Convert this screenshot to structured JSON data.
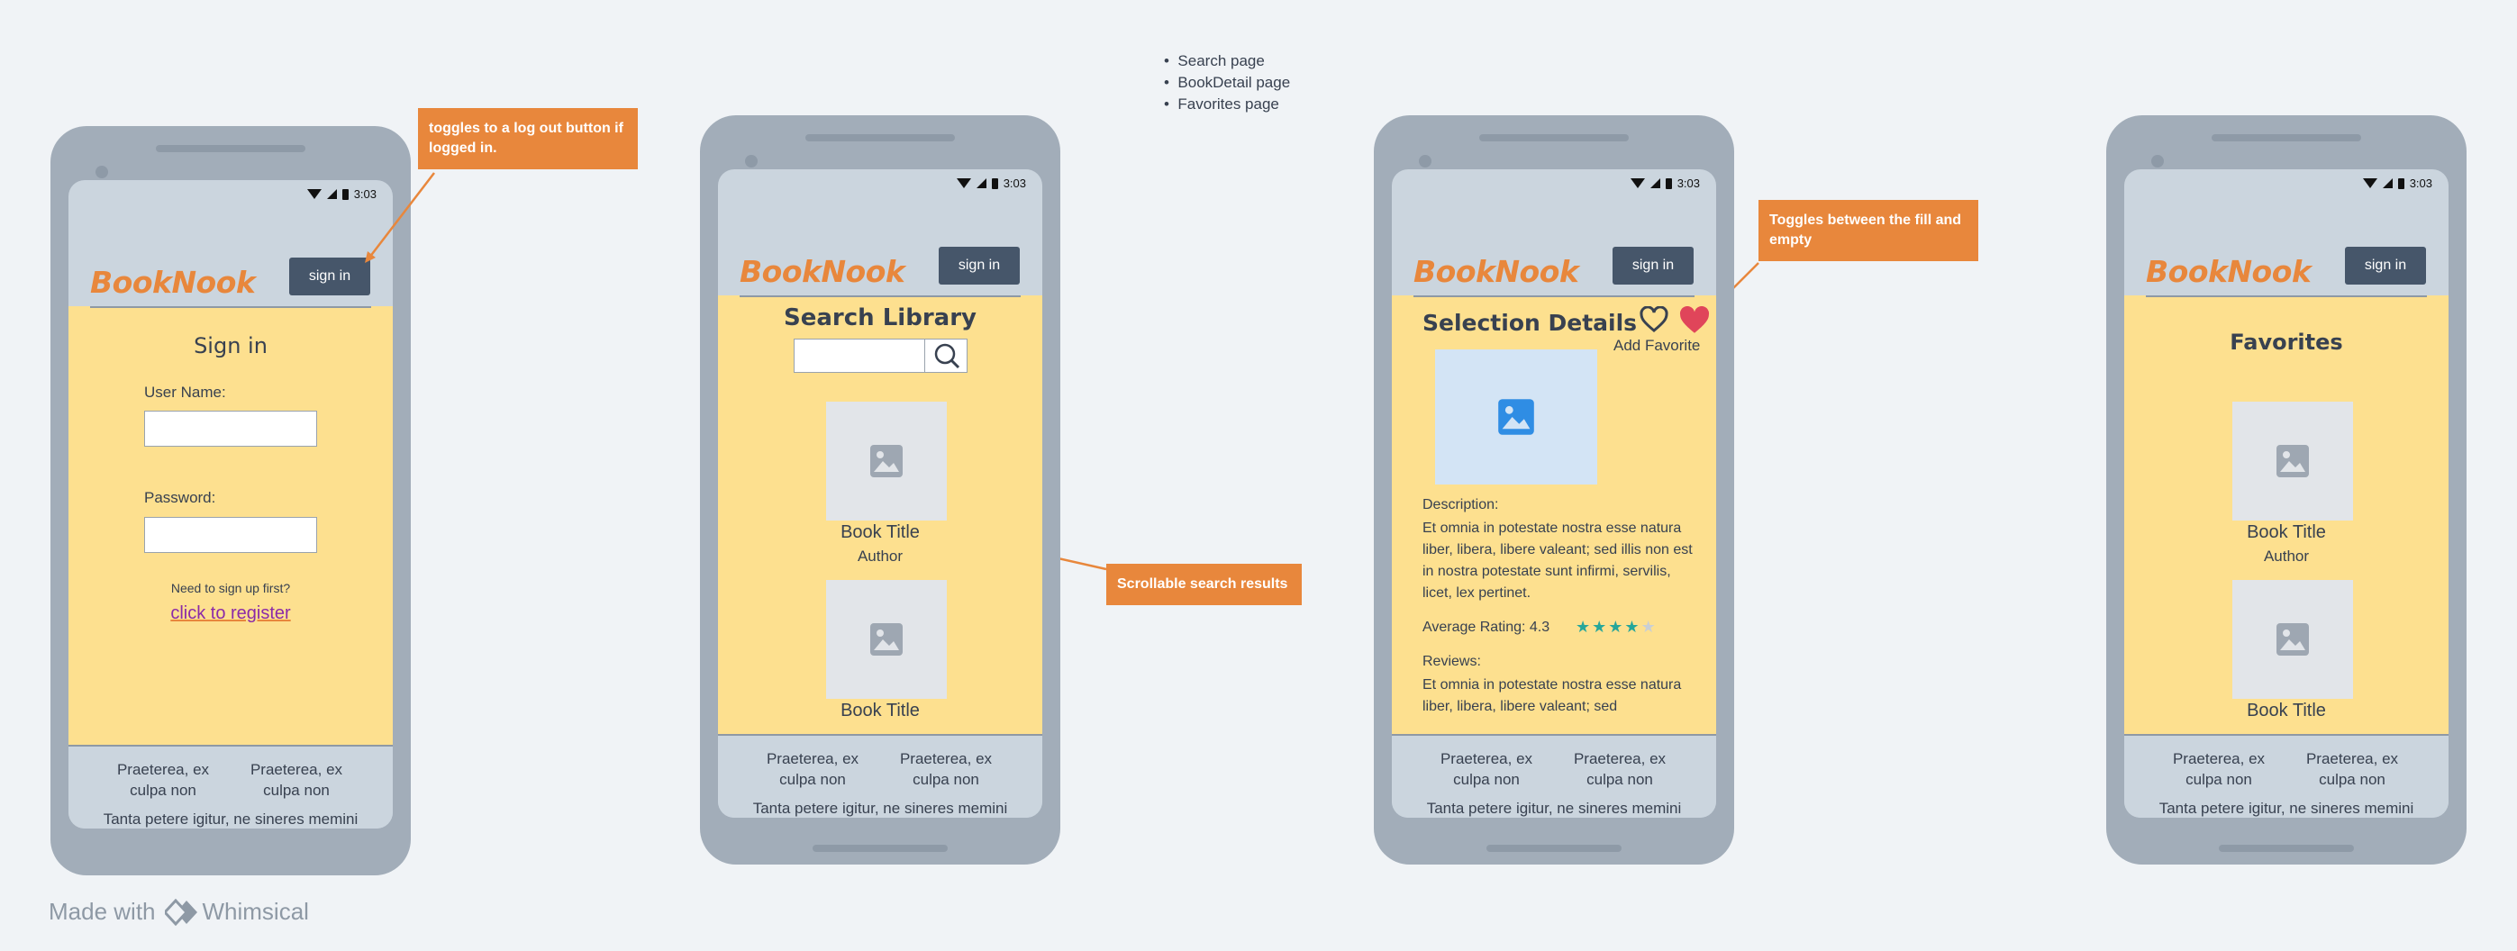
{
  "notes": {
    "bullets": [
      "Search page",
      "BookDetail page",
      "Favorites page"
    ],
    "toggle_logout": "toggles to a log out button if logged in.",
    "scrollable": "Scrollable search results",
    "toggle_fill": "Toggles between the fill and empty"
  },
  "common": {
    "time": "3:03",
    "logo": "BookNook",
    "sign_in_btn": "sign in",
    "footer_col1": "Praeterea, ex culpa non",
    "footer_col2": "Praeterea, ex culpa non",
    "footer_bottom": "Tanta petere igitur, ne sineres memini"
  },
  "signin": {
    "title": "Sign in",
    "username_label": "User Name:",
    "username_value": "",
    "password_label": "Password:",
    "password_value": "",
    "signup_prompt": "Need to sign up first?",
    "register_link": "click to register"
  },
  "search": {
    "title": "Search Library",
    "input_value": "",
    "results": [
      {
        "title": "Book Title",
        "author": "Author"
      },
      {
        "title": "Book Title",
        "author": ""
      }
    ]
  },
  "detail": {
    "title": "Selection Details",
    "add_favorite": "Add Favorite",
    "description_label": "Description:",
    "description": "Et omnia in potestate nostra esse natura liber, libera, libere valeant; sed illis non est in nostra potestate sunt infirmi, servilis, licet, lex pertinet.",
    "rating_label": "Average Rating: 4.3",
    "rating_value": 4,
    "rating_max": 5,
    "reviews_label": "Reviews:",
    "reviews": "Et omnia in potestate nostra esse natura liber, libera, libere valeant; sed"
  },
  "favorites": {
    "title": "Favorites",
    "items": [
      {
        "title": "Book Title",
        "author": "Author"
      },
      {
        "title": "Book Title",
        "author": ""
      }
    ]
  },
  "branding": {
    "made_with": "Made with",
    "brand": "Whimsical"
  },
  "colors": {
    "accent": "#e8873c",
    "header_bg": "#cbd5de",
    "content_bg": "#fde08f",
    "button_bg": "#46566a",
    "heart": "#e0455a",
    "star": "#26a69a"
  }
}
